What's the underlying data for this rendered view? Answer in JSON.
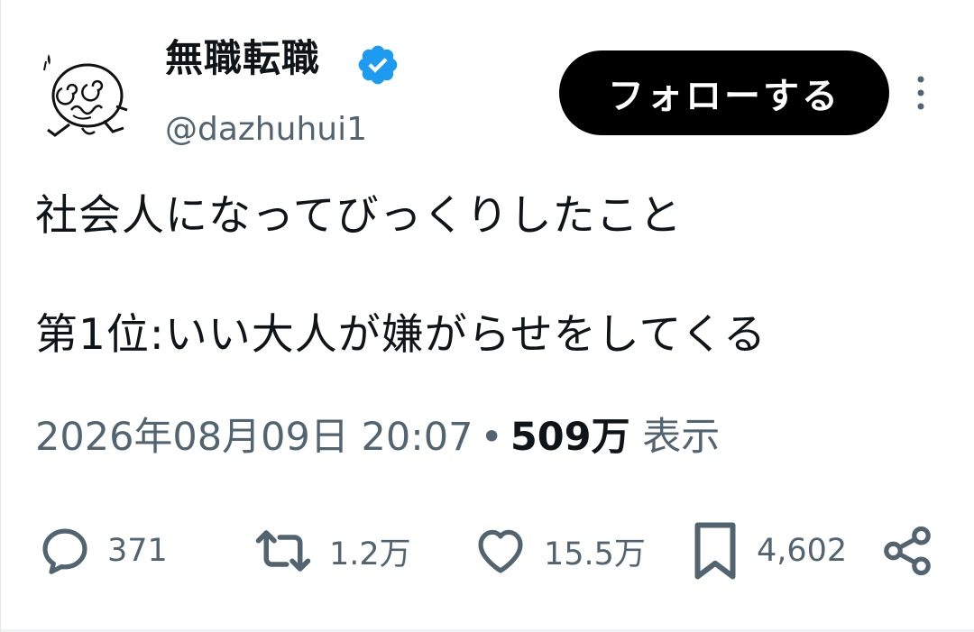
{
  "author": {
    "display_name": "無職転職",
    "handle": "@dazhuhui1",
    "avatar_icon": "doodle-avatar-icon",
    "verified_icon": "verified-badge-icon",
    "verified_color": "#1d9bf0"
  },
  "follow_button": {
    "label": "フォローする",
    "bg_color": "#000000",
    "text_color": "#ffffff"
  },
  "more_icon": "more-vertical-icon",
  "body": {
    "line1": "社会人になってびっくりしたこと",
    "line2": "第1位:いい大人が嫌がらせをしてくる"
  },
  "meta": {
    "datetime": "2026年08月09日 20:07",
    "separator": "•",
    "views_count": "509万",
    "views_label": "表示"
  },
  "actions": {
    "reply": {
      "icon": "reply-icon",
      "count": "371"
    },
    "repost": {
      "icon": "repost-icon",
      "count": "1.2万"
    },
    "like": {
      "icon": "heart-icon",
      "count": "15.5万"
    },
    "bookmark": {
      "icon": "bookmark-icon",
      "count": "4,602"
    },
    "share": {
      "icon": "share-icon"
    }
  },
  "colors": {
    "text_primary": "#0f1419",
    "text_secondary": "#536471"
  }
}
